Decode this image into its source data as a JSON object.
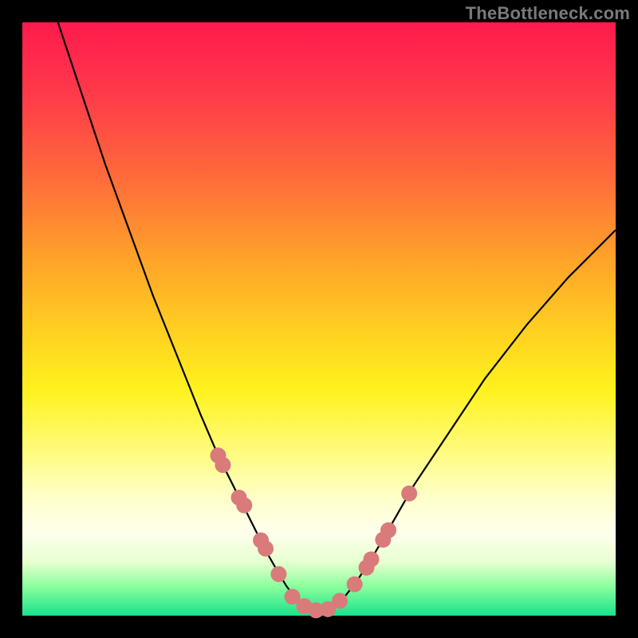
{
  "watermark": "TheBottleneck.com",
  "chart_data": {
    "type": "line",
    "title": "",
    "xlabel": "",
    "ylabel": "",
    "xlim": [
      0,
      100
    ],
    "ylim": [
      0,
      100
    ],
    "series": [
      {
        "name": "curve",
        "x": [
          6,
          10,
          14,
          18,
          22,
          26,
          30,
          33,
          36,
          39,
          41,
          43,
          44.5,
          46,
          48,
          50,
          52,
          54,
          56,
          58.5,
          62,
          66,
          72,
          78,
          85,
          92,
          100
        ],
        "y": [
          100,
          88,
          76,
          65,
          54,
          44,
          34,
          27,
          21,
          15,
          11,
          7.5,
          5,
          3,
          1.4,
          0.8,
          1.2,
          2.8,
          5.3,
          9,
          15,
          22,
          31,
          40,
          49,
          57,
          65
        ]
      }
    ],
    "markers": {
      "name": "dots",
      "x": [
        33.0,
        33.8,
        36.5,
        37.4,
        40.2,
        41.0,
        43.2,
        45.5,
        47.5,
        49.5,
        51.5,
        53.5,
        56.0,
        58.0,
        58.8,
        60.8,
        61.7,
        65.2
      ],
      "y": [
        27.0,
        25.4,
        19.9,
        18.6,
        12.7,
        11.3,
        7.0,
        3.2,
        1.6,
        0.9,
        1.1,
        2.5,
        5.3,
        8.1,
        9.5,
        12.8,
        14.4,
        20.6
      ]
    },
    "background_gradient": [
      "#ff1a4d",
      "#ffa329",
      "#fff21e",
      "#ffffee",
      "#18e28c"
    ]
  }
}
